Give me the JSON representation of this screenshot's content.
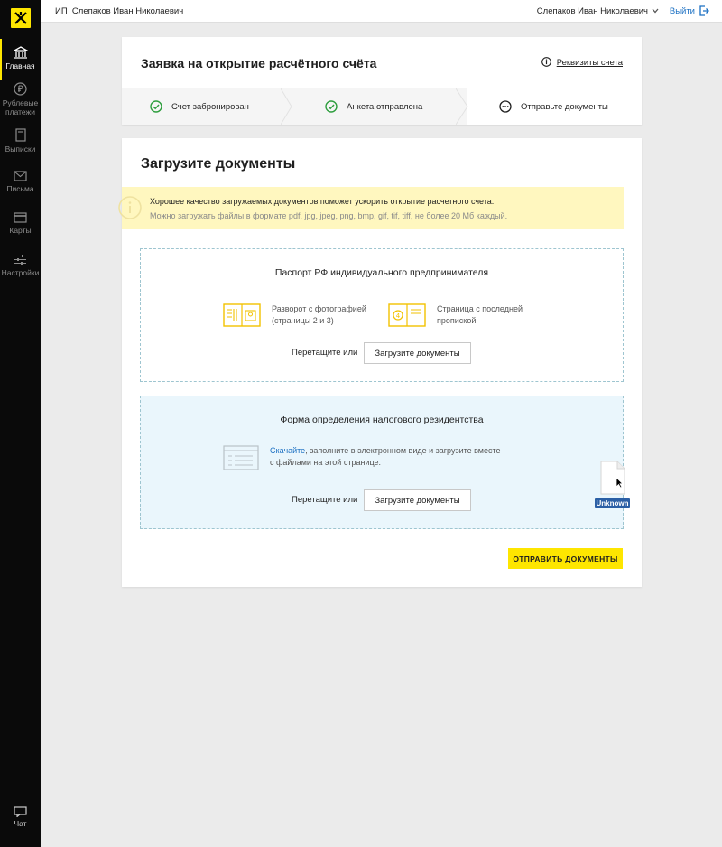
{
  "sidebar": {
    "logo_icon": "raiffeisen-logo-icon",
    "items": [
      {
        "label": "Главная",
        "icon": "bank-icon",
        "active": true
      },
      {
        "label": "Рублевые платежи",
        "icon": "ruble-icon",
        "active": false
      },
      {
        "label": "Выписки",
        "icon": "statement-icon",
        "active": false
      },
      {
        "label": "Письма",
        "icon": "envelope-icon",
        "active": false
      },
      {
        "label": "Карты",
        "icon": "card-icon",
        "active": false
      },
      {
        "label": "Настройки",
        "icon": "settings-icon",
        "active": false
      }
    ],
    "chat_label": "Чат"
  },
  "header": {
    "org_name": "ИП  Слепаков Иван Николаевич",
    "user_name": "Слепаков Иван Николаевич",
    "logout_label": "Выйти"
  },
  "application": {
    "title": "Заявка на открытие расчётного счёта",
    "requisites_link": "Реквизиты счета",
    "steps": [
      {
        "label": "Счет забронирован",
        "status": "done"
      },
      {
        "label": "Анкета отправлена",
        "status": "done"
      },
      {
        "label": "Отправьте документы",
        "status": "current"
      }
    ]
  },
  "upload": {
    "title": "Загрузите документы",
    "info_line1": "Хорошее качество загружаемых документов поможет ускорить открытие расчетного счета.",
    "info_line2": "Можно загружать файлы в формате pdf, jpg, jpeg, png, bmp, gif, tif, tiff, не более 20 Мб каждый.",
    "passport": {
      "title": "Паспорт РФ индивидуального предпринимателя",
      "doc1_line1": "Разворот с фотографией",
      "doc1_line2": "(страницы 2 и 3)",
      "doc2_line1": "Страница с последней",
      "doc2_line2": "пропиской",
      "drag_text": "Перетащите или",
      "button_label": "Загрузите документы"
    },
    "tax_form": {
      "title": "Форма определения налогового резидентства",
      "download_link": "Скачайте",
      "text_line1_rest": ", заполните в электронном виде и загрузите вместе",
      "text_line2": "с файлами на этой странице.",
      "drag_text": "Перетащите или",
      "button_label": "Загрузите документы"
    },
    "submit_label": "ОТПРАВИТЬ ДОКУМЕНТЫ",
    "drag_ghost_label": "Unknown"
  },
  "colors": {
    "accent_yellow": "#fee600",
    "link_blue": "#1a6fc2",
    "success_green": "#2e9e3e",
    "info_bg": "#fff7bf",
    "dropzone_active_bg": "#eaf6fc"
  }
}
